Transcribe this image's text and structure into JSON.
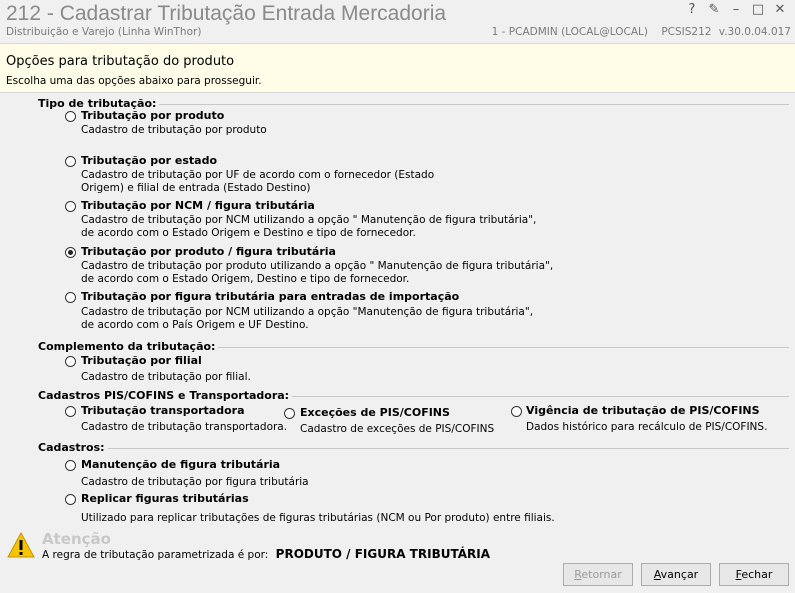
{
  "window": {
    "title": "212 - Cadastrar Tributação Entrada Mercadoria",
    "subtitle": "Distribuição e Varejo (Linha WinThor)",
    "user": "1 - PCADMIN (LOCAL@LOCAL)",
    "module": "PCSIS212",
    "version": "v.30.0.04.017",
    "buttons": {
      "help": "?",
      "edit": "✎",
      "minimize": "–",
      "maximize": "□",
      "close": "✕"
    }
  },
  "header": {
    "title": "Opções para tributação do produto",
    "description": "Escolha uma das opções abaixo para prosseguir."
  },
  "sections": {
    "tipo": "Tipo de tributação:",
    "complemento": "Complemento da tributação:",
    "pis": "Cadastros PIS/COFINS e Transportadora:",
    "cadastros": "Cadastros:"
  },
  "options": {
    "produto": {
      "title": "Tributação por produto",
      "desc": [
        "Cadastro de tributação por produto"
      ],
      "checked": false
    },
    "estado": {
      "title": "Tributação por estado",
      "desc": [
        "Cadastro de tributação por UF de acordo com o fornecedor (Estado",
        "Origem) e filial de entrada (Estado Destino)"
      ],
      "checked": false
    },
    "ncm": {
      "title": "Tributação por NCM / figura tributária",
      "desc": [
        "Cadastro de tributação por NCM utilizando a opção \" Manutenção de figura tributária\",",
        "de acordo com o Estado Origem e Destino e tipo de fornecedor."
      ],
      "checked": false
    },
    "produto_figura": {
      "title": "Tributação por produto / figura tributária",
      "desc": [
        "Cadastro de tributação por produto utilizando a opção \" Manutenção de figura tributária\",",
        "de acordo com o Estado Origem, Destino e tipo de fornecedor."
      ],
      "checked": true
    },
    "importacao": {
      "title": "Tributação por figura tributária para entradas de importação",
      "desc": [
        "Cadastro de tributação por NCM utilizando a opção \"Manutenção de figura tributária\",",
        "de acordo com o País Origem e UF Destino."
      ],
      "checked": false
    },
    "filial": {
      "title": "Tributação por filial",
      "desc": [
        "Cadastro de tributação por filial."
      ],
      "checked": false
    },
    "transportadora": {
      "title": "Tributação  transportadora",
      "desc": [
        "Cadastro de tributação transportadora."
      ],
      "checked": false
    },
    "excecoes": {
      "title": "Exceções de PIS/COFINS",
      "desc": [
        "Cadastro de exceções de PIS/COFINS"
      ],
      "checked": false
    },
    "vigencia": {
      "title": "Vigência de tributação de PIS/COFINS",
      "desc": [
        "Dados histórico para recálculo de PIS/COFINS."
      ],
      "checked": false
    },
    "manutencao": {
      "title": "Manutenção de figura tributária",
      "desc": [
        "Cadastro de tributação por figura tributária"
      ],
      "checked": false
    },
    "replicar": {
      "title": "Replicar figuras tributárias",
      "desc": [
        "Utilizado para replicar tributações de figuras tributárias (NCM ou Por produto) entre filiais."
      ],
      "checked": false
    }
  },
  "warning": {
    "title": "Atenção",
    "text": "A regra de tributação parametrizada é por:",
    "value": "PRODUTO / FIGURA TRIBUTÁRIA"
  },
  "buttons": {
    "retornar": {
      "first": "R",
      "rest": "etornar",
      "enabled": false
    },
    "avancar": {
      "first": "A",
      "rest": "vançar",
      "enabled": true
    },
    "fechar": {
      "first": "F",
      "rest": "echar",
      "enabled": true
    }
  }
}
